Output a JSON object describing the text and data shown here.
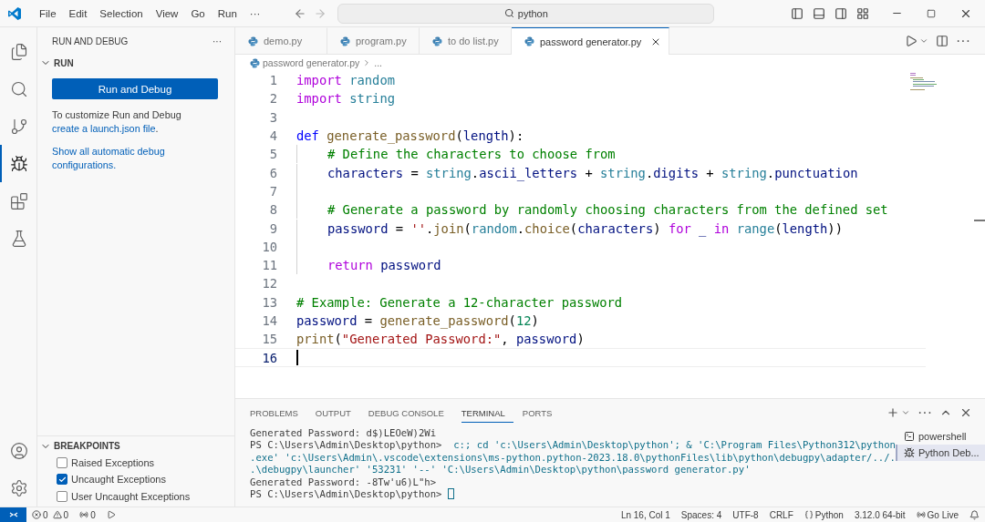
{
  "title_bar": {
    "menus": [
      "File",
      "Edit",
      "Selection",
      "View",
      "Go",
      "Run"
    ],
    "more": "···",
    "search": "python"
  },
  "activity_bar": {
    "items": [
      {
        "kind": "files",
        "selected": false
      },
      {
        "kind": "search",
        "selected": false
      },
      {
        "kind": "source-control",
        "selected": false
      },
      {
        "kind": "run-debug",
        "selected": true
      },
      {
        "kind": "extensions",
        "selected": false
      },
      {
        "kind": "testing",
        "selected": false
      }
    ]
  },
  "sidebar": {
    "title": "RUN AND DEBUG",
    "more": "···",
    "run": {
      "title": "RUN",
      "expanded": true,
      "button": "Run and Debug",
      "hint": "To customize Run and Debug ",
      "hint_link": "create a launch.json file",
      "hint_end": ".",
      "link": "Show all automatic debug configurations."
    },
    "breakpoints": {
      "title": "BREAKPOINTS",
      "expanded": true,
      "items": [
        {
          "label": "Raised Exceptions",
          "checked": false
        },
        {
          "label": "Uncaught Exceptions",
          "checked": true
        },
        {
          "label": "User Uncaught Exceptions",
          "checked": false
        }
      ]
    }
  },
  "tabs": [
    {
      "label": "demo.py",
      "selected": false
    },
    {
      "label": "program.py",
      "selected": false
    },
    {
      "label": "to do list.py",
      "selected": false
    },
    {
      "label": "password generator.py",
      "selected": true
    }
  ],
  "breadcrumb": [
    "password generator.py",
    "..."
  ],
  "code": [
    {
      "number": "1",
      "indented": false,
      "current": false,
      "tokens": [
        {
          "kind": "control",
          "text": "import"
        },
        {
          "kind": "module",
          "text": " random"
        }
      ]
    },
    {
      "number": "2",
      "indented": false,
      "current": false,
      "tokens": [
        {
          "kind": "control",
          "text": "import"
        },
        {
          "kind": "module",
          "text": " string"
        }
      ]
    },
    {
      "number": "3",
      "indented": false,
      "current": false
    },
    {
      "number": "4",
      "indented": false,
      "current": false,
      "tokens": [
        {
          "kind": "def",
          "text": "def"
        },
        {
          "kind": "func",
          "text": " generate_password"
        },
        {
          "kind": "plain",
          "text": "("
        },
        {
          "kind": "var",
          "text": "length"
        },
        {
          "kind": "plain",
          "text": "):"
        }
      ]
    },
    {
      "number": "5",
      "indented": true,
      "current": false,
      "tokens": [
        {
          "kind": "comment",
          "text": "# Define the characters to choose from"
        }
      ]
    },
    {
      "number": "6",
      "indented": true,
      "current": false,
      "tokens": [
        {
          "kind": "var",
          "text": "characters"
        },
        {
          "kind": "plain",
          "text": " = "
        },
        {
          "kind": "module",
          "text": "string"
        },
        {
          "kind": "plain",
          "text": "."
        },
        {
          "kind": "var",
          "text": "ascii_letters"
        },
        {
          "kind": "plain",
          "text": " + "
        },
        {
          "kind": "module",
          "text": "string"
        },
        {
          "kind": "plain",
          "text": "."
        },
        {
          "kind": "var",
          "text": "digits"
        },
        {
          "kind": "plain",
          "text": " + "
        },
        {
          "kind": "module",
          "text": "string"
        },
        {
          "kind": "plain",
          "text": "."
        },
        {
          "kind": "var",
          "text": "punctuation"
        }
      ]
    },
    {
      "number": "7",
      "indented": true,
      "current": false
    },
    {
      "number": "8",
      "indented": true,
      "current": false,
      "tokens": [
        {
          "kind": "comment",
          "text": "# Generate a password by randomly choosing characters from the defined set"
        }
      ]
    },
    {
      "number": "9",
      "indented": true,
      "current": false,
      "tokens": [
        {
          "kind": "var",
          "text": "password"
        },
        {
          "kind": "plain",
          "text": " = "
        },
        {
          "kind": "string",
          "text": "''"
        },
        {
          "kind": "plain",
          "text": "."
        },
        {
          "kind": "func",
          "text": "join"
        },
        {
          "kind": "plain",
          "text": "("
        },
        {
          "kind": "module",
          "text": "random"
        },
        {
          "kind": "plain",
          "text": "."
        },
        {
          "kind": "func",
          "text": "choice"
        },
        {
          "kind": "plain",
          "text": "("
        },
        {
          "kind": "var",
          "text": "characters"
        },
        {
          "kind": "plain",
          "text": ") "
        },
        {
          "kind": "control",
          "text": "for"
        },
        {
          "kind": "var",
          "text": " _ "
        },
        {
          "kind": "control",
          "text": "in"
        },
        {
          "kind": "module",
          "text": " range"
        },
        {
          "kind": "plain",
          "text": "("
        },
        {
          "kind": "var",
          "text": "length"
        },
        {
          "kind": "plain",
          "text": "))"
        }
      ]
    },
    {
      "number": "10",
      "indented": true,
      "current": false
    },
    {
      "number": "11",
      "indented": true,
      "current": false,
      "tokens": [
        {
          "kind": "control",
          "text": "return"
        },
        {
          "kind": "var",
          "text": " password"
        }
      ]
    },
    {
      "number": "12",
      "indented": false,
      "current": false
    },
    {
      "number": "13",
      "indented": false,
      "current": false,
      "tokens": [
        {
          "kind": "comment",
          "text": "# Example: Generate a 12-character password"
        }
      ]
    },
    {
      "number": "14",
      "indented": false,
      "current": false,
      "tokens": [
        {
          "kind": "var",
          "text": "password"
        },
        {
          "kind": "plain",
          "text": " = "
        },
        {
          "kind": "func",
          "text": "generate_password"
        },
        {
          "kind": "plain",
          "text": "("
        },
        {
          "kind": "number",
          "text": "12"
        },
        {
          "kind": "plain",
          "text": ")"
        }
      ]
    },
    {
      "number": "15",
      "indented": false,
      "current": false,
      "tokens": [
        {
          "kind": "func",
          "text": "print"
        },
        {
          "kind": "plain",
          "text": "("
        },
        {
          "kind": "string",
          "text": "\"Generated Password:\""
        },
        {
          "kind": "plain",
          "text": ", "
        },
        {
          "kind": "var",
          "text": "password"
        },
        {
          "kind": "plain",
          "text": ")"
        }
      ]
    },
    {
      "number": "16",
      "indented": false,
      "current": true
    }
  ],
  "panel": {
    "tabs": [
      {
        "label": "PROBLEMS",
        "selected": false
      },
      {
        "label": "OUTPUT",
        "selected": false
      },
      {
        "label": "DEBUG CONSOLE",
        "selected": false
      },
      {
        "label": "TERMINAL",
        "selected": true
      },
      {
        "label": "PORTS",
        "selected": false
      }
    ],
    "terminal_lines": [
      {
        "cursor": false,
        "tokens": [
          {
            "kind": "output",
            "text": "Generated Password: d$)LEOeW)2Wi"
          }
        ]
      },
      {
        "cursor": false,
        "tokens": [
          {
            "kind": "output",
            "text": "PS C:\\Users\\Admin\\Desktop\\python> "
          },
          {
            "kind": "command",
            "text": " c:; cd 'c:\\Users\\Admin\\Desktop\\python'; & 'C:\\Program Files\\Python312\\python"
          }
        ]
      },
      {
        "cursor": false,
        "tokens": [
          {
            "kind": "command",
            "text": ".exe' 'c:\\Users\\Admin\\.vscode\\extensions\\ms-python.python-2023.18.0\\pythonFiles\\lib\\python\\debugpy\\adapter/../."
          }
        ]
      },
      {
        "cursor": false,
        "tokens": [
          {
            "kind": "command",
            "text": ".\\debugpy\\launcher' '53231' '--' 'C:\\Users\\Admin\\Desktop\\python\\password generator.py'"
          }
        ]
      },
      {
        "cursor": false,
        "tokens": [
          {
            "kind": "output",
            "text": "Generated Password: -8Tw'u6)L\"h>"
          }
        ]
      },
      {
        "cursor": true,
        "tokens": [
          {
            "kind": "output",
            "text": "PS C:\\Users\\Admin\\Desktop\\python> "
          }
        ]
      }
    ],
    "terminals": [
      {
        "kind": "shell",
        "label": "powershell",
        "selected": false
      },
      {
        "kind": "debug",
        "label": "Python Deb...",
        "selected": true
      }
    ]
  },
  "status_bar": {
    "errors": "0",
    "warnings": "0",
    "ports": "0",
    "position": "Ln 16, Col 1",
    "spaces": "Spaces: 4",
    "encoding": "UTF-8",
    "eol": "CRLF",
    "language": "Python",
    "interpreter": "3.12.0 64-bit",
    "live": "Go Live"
  }
}
